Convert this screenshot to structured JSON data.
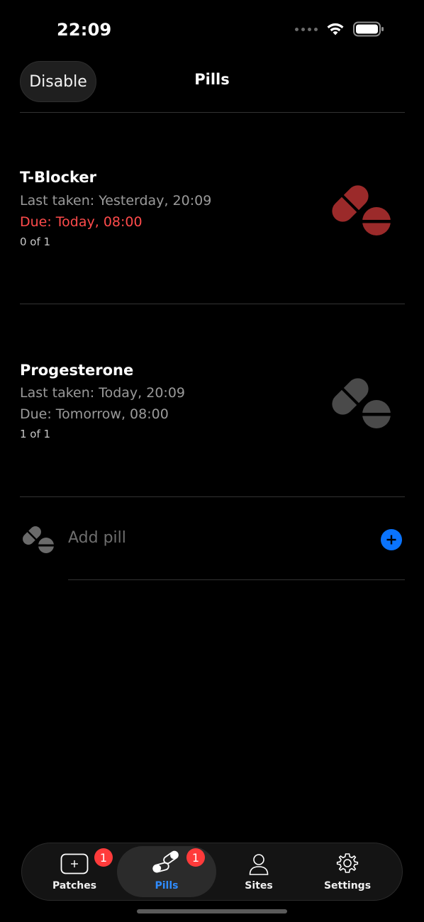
{
  "status_bar": {
    "time": "22:09"
  },
  "nav": {
    "left_button": "Disable",
    "title": "Pills"
  },
  "pills": [
    {
      "name": "T-Blocker",
      "last_taken": "Last taken: Yesterday, 20:09",
      "due": "Due: Today, 08:00",
      "count": "0 of 1",
      "overdue": true,
      "icon": "pill-icon",
      "icon_color": "#9b2a2a"
    },
    {
      "name": "Progesterone",
      "last_taken": "Last taken: Today, 20:09",
      "due": "Due: Tomorrow, 08:00",
      "count": "1 of 1",
      "overdue": false,
      "icon": "pill-icon",
      "icon_color": "#4a4a4a"
    }
  ],
  "add_pill": {
    "label": "Add pill",
    "accent": "#0a74ff"
  },
  "tab_bar": {
    "selected": "Pills",
    "tabs": [
      {
        "label": "Patches",
        "icon": "patch-icon",
        "badge": "1"
      },
      {
        "label": "Pills",
        "icon": "pills-icon",
        "badge": "1"
      },
      {
        "label": "Sites",
        "icon": "person-icon",
        "badge": ""
      },
      {
        "label": "Settings",
        "icon": "gear-icon",
        "badge": ""
      }
    ]
  },
  "colors": {
    "background": "#000000",
    "overdue": "#ff4b4b",
    "tab_selected": "#2f8cff",
    "badge": "#ff3b3b"
  }
}
